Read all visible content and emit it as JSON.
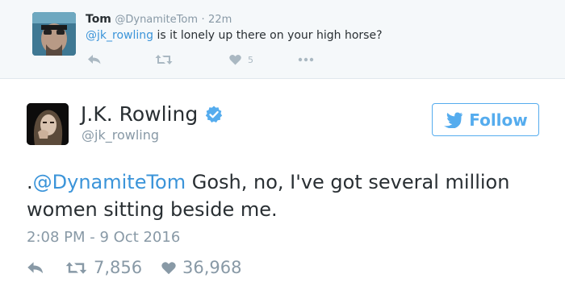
{
  "reply": {
    "avatar_icon": "walter-white-avatar",
    "name": "Tom",
    "handle": "@DynamiteTom",
    "separator": "·",
    "time": "22m",
    "mention": "@jk_rowling",
    "text": " is it lonely up there on your high horse?",
    "actions": {
      "reply_icon": "reply-icon",
      "retweet_icon": "retweet-icon",
      "like_icon": "heart-icon",
      "like_count": "5",
      "more_icon": "more-icon"
    }
  },
  "tweet": {
    "avatar_icon": "jk-rowling-avatar",
    "name": "J.K. Rowling",
    "verified_icon": "verified-badge-icon",
    "handle": "@jk_rowling",
    "follow_label": "Follow",
    "text_prefix": ".",
    "mention": "@DynamiteTom",
    "text": " Gosh, no, I've got several million women sitting beside me.",
    "timestamp": "2:08 PM - 9 Oct 2016",
    "retweet_count": "7,856",
    "like_count": "36,968"
  },
  "colors": {
    "accent": "#55acee",
    "link": "#3b94d9",
    "muted": "#8899a6",
    "reply_background": "#f5f8fa"
  }
}
